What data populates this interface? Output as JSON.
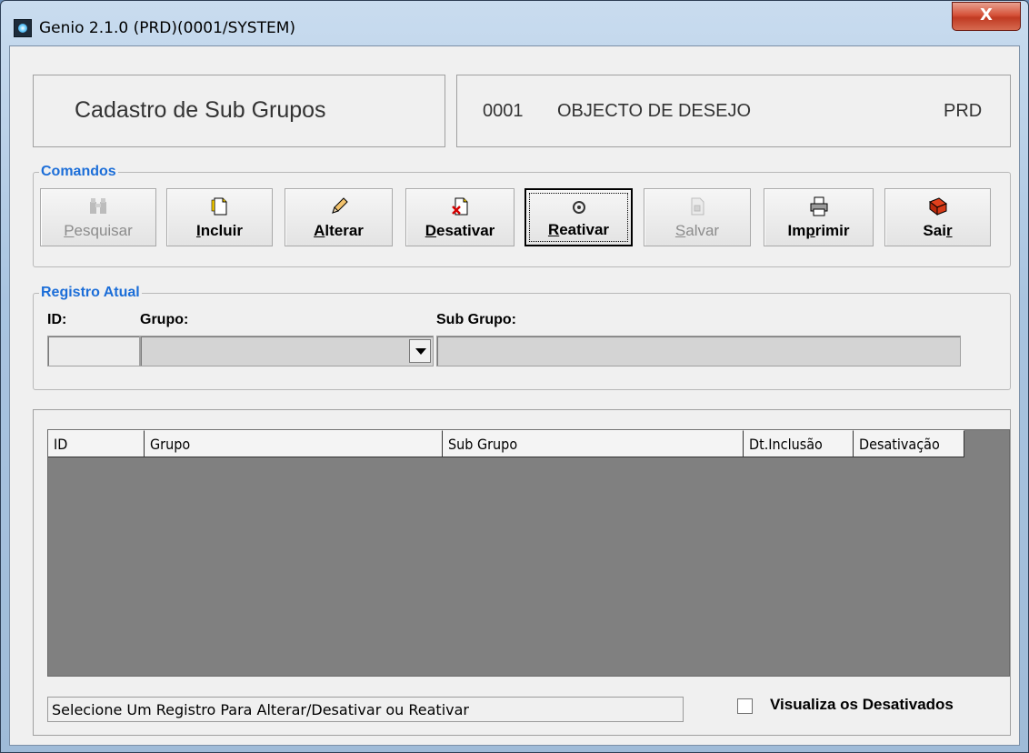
{
  "window": {
    "title": "Genio 2.1.0 (PRD)(0001/SYSTEM)",
    "close_label": "X"
  },
  "header": {
    "screen_title": "Cadastro de Sub Grupos",
    "company_code": "0001",
    "company_name": "OBJECTO DE DESEJO",
    "environment": "PRD"
  },
  "commands": {
    "label": "Comandos",
    "buttons": [
      {
        "pre": "",
        "u": "P",
        "post": "esquisar",
        "enabled": false,
        "icon": "binoculars-icon"
      },
      {
        "pre": "",
        "u": "I",
        "post": "ncluir",
        "enabled": true,
        "icon": "new-document-icon"
      },
      {
        "pre": "",
        "u": "A",
        "post": "lterar",
        "enabled": true,
        "icon": "pencil-icon"
      },
      {
        "pre": "",
        "u": "D",
        "post": "esativar",
        "enabled": true,
        "icon": "delete-document-icon"
      },
      {
        "pre": "",
        "u": "R",
        "post": "eativar",
        "enabled": true,
        "icon": "reactivate-icon"
      },
      {
        "pre": "",
        "u": "S",
        "post": "alvar",
        "enabled": false,
        "icon": "save-disk-icon"
      },
      {
        "pre": "Im",
        "u": "p",
        "post": "rimir",
        "enabled": true,
        "icon": "printer-icon"
      },
      {
        "pre": "Sai",
        "u": "r",
        "post": "",
        "enabled": true,
        "icon": "exit-icon"
      }
    ]
  },
  "current_record": {
    "label": "Registro Atual",
    "id_label": "ID:",
    "group_label": "Grupo:",
    "subgroup_label": "Sub Grupo:",
    "id_value": "",
    "group_value": "",
    "subgroup_value": ""
  },
  "grid": {
    "columns": [
      "ID",
      "Grupo",
      "Sub Grupo",
      "Dt.Inclusão",
      "Desativação"
    ],
    "rows": []
  },
  "status_text": "Selecione Um Registro Para Alterar/Desativar ou Reativar",
  "show_deactivated": {
    "label": "Visualiza os Desativados",
    "checked": false
  },
  "colors": {
    "group_label": "#1c6ed8",
    "grid_background": "#808080",
    "close_button": "#c03a22"
  }
}
